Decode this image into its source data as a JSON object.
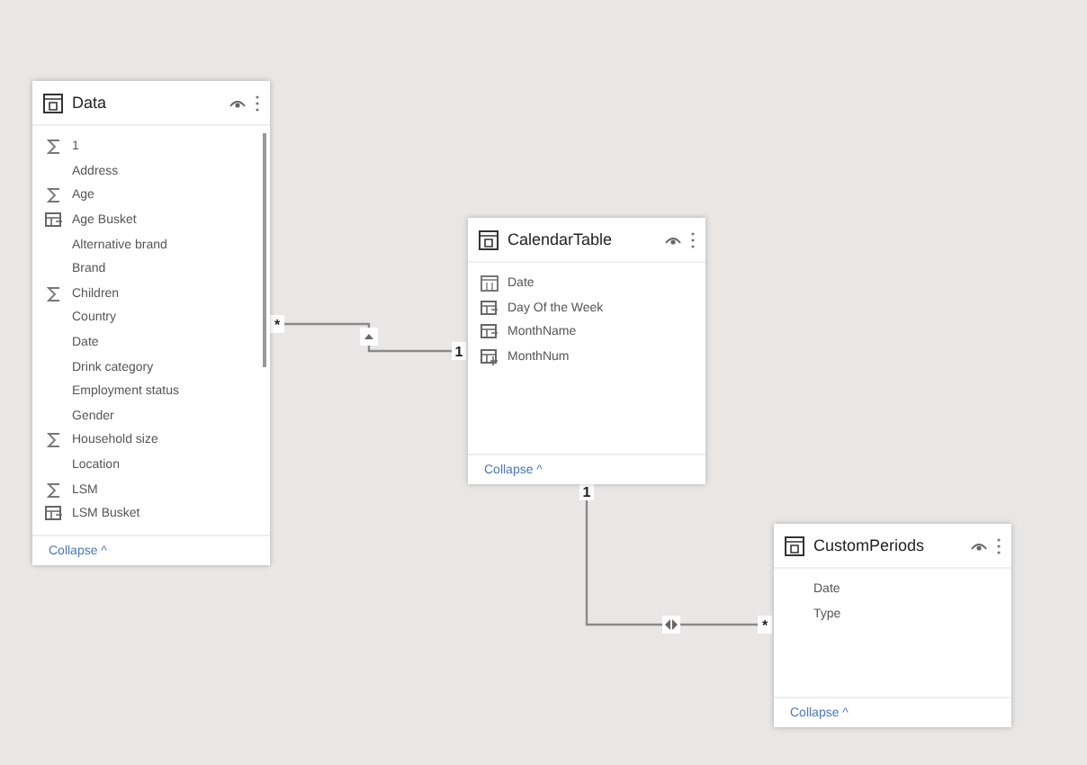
{
  "tables": [
    {
      "title": "Data",
      "fields": [
        {
          "name": "1",
          "kind": "sigma"
        },
        {
          "name": "Address",
          "kind": "plain"
        },
        {
          "name": "Age",
          "kind": "sigma"
        },
        {
          "name": "Age Busket",
          "kind": "calc"
        },
        {
          "name": "Alternative brand",
          "kind": "plain"
        },
        {
          "name": "Brand",
          "kind": "plain"
        },
        {
          "name": "Children",
          "kind": "sigma"
        },
        {
          "name": "Country",
          "kind": "plain"
        },
        {
          "name": "Date",
          "kind": "plain"
        },
        {
          "name": "Drink category",
          "kind": "plain"
        },
        {
          "name": "Employment status",
          "kind": "plain"
        },
        {
          "name": "Gender",
          "kind": "plain"
        },
        {
          "name": "Household size",
          "kind": "sigma"
        },
        {
          "name": "Location",
          "kind": "plain"
        },
        {
          "name": "LSM",
          "kind": "sigma"
        },
        {
          "name": "LSM Busket",
          "kind": "calc"
        }
      ],
      "collapse": "Collapse ^",
      "scrollbar": true
    },
    {
      "title": "CalendarTable",
      "fields": [
        {
          "name": "Date",
          "kind": "calendar"
        },
        {
          "name": "Day Of the Week",
          "kind": "calc"
        },
        {
          "name": "MonthName",
          "kind": "calc"
        },
        {
          "name": "MonthNum",
          "kind": "hierarchy"
        }
      ],
      "collapse": "Collapse ^",
      "scrollbar": false
    },
    {
      "title": "CustomPeriods",
      "fields": [
        {
          "name": "Date",
          "kind": "plain"
        },
        {
          "name": "Type",
          "kind": "plain"
        }
      ],
      "collapse": "Collapse ^",
      "scrollbar": false
    }
  ],
  "relationships": [
    {
      "from_label": "*",
      "to_label": "1",
      "bidirectional": false
    },
    {
      "from_label": "1",
      "to_label": "*",
      "bidirectional": true
    }
  ]
}
